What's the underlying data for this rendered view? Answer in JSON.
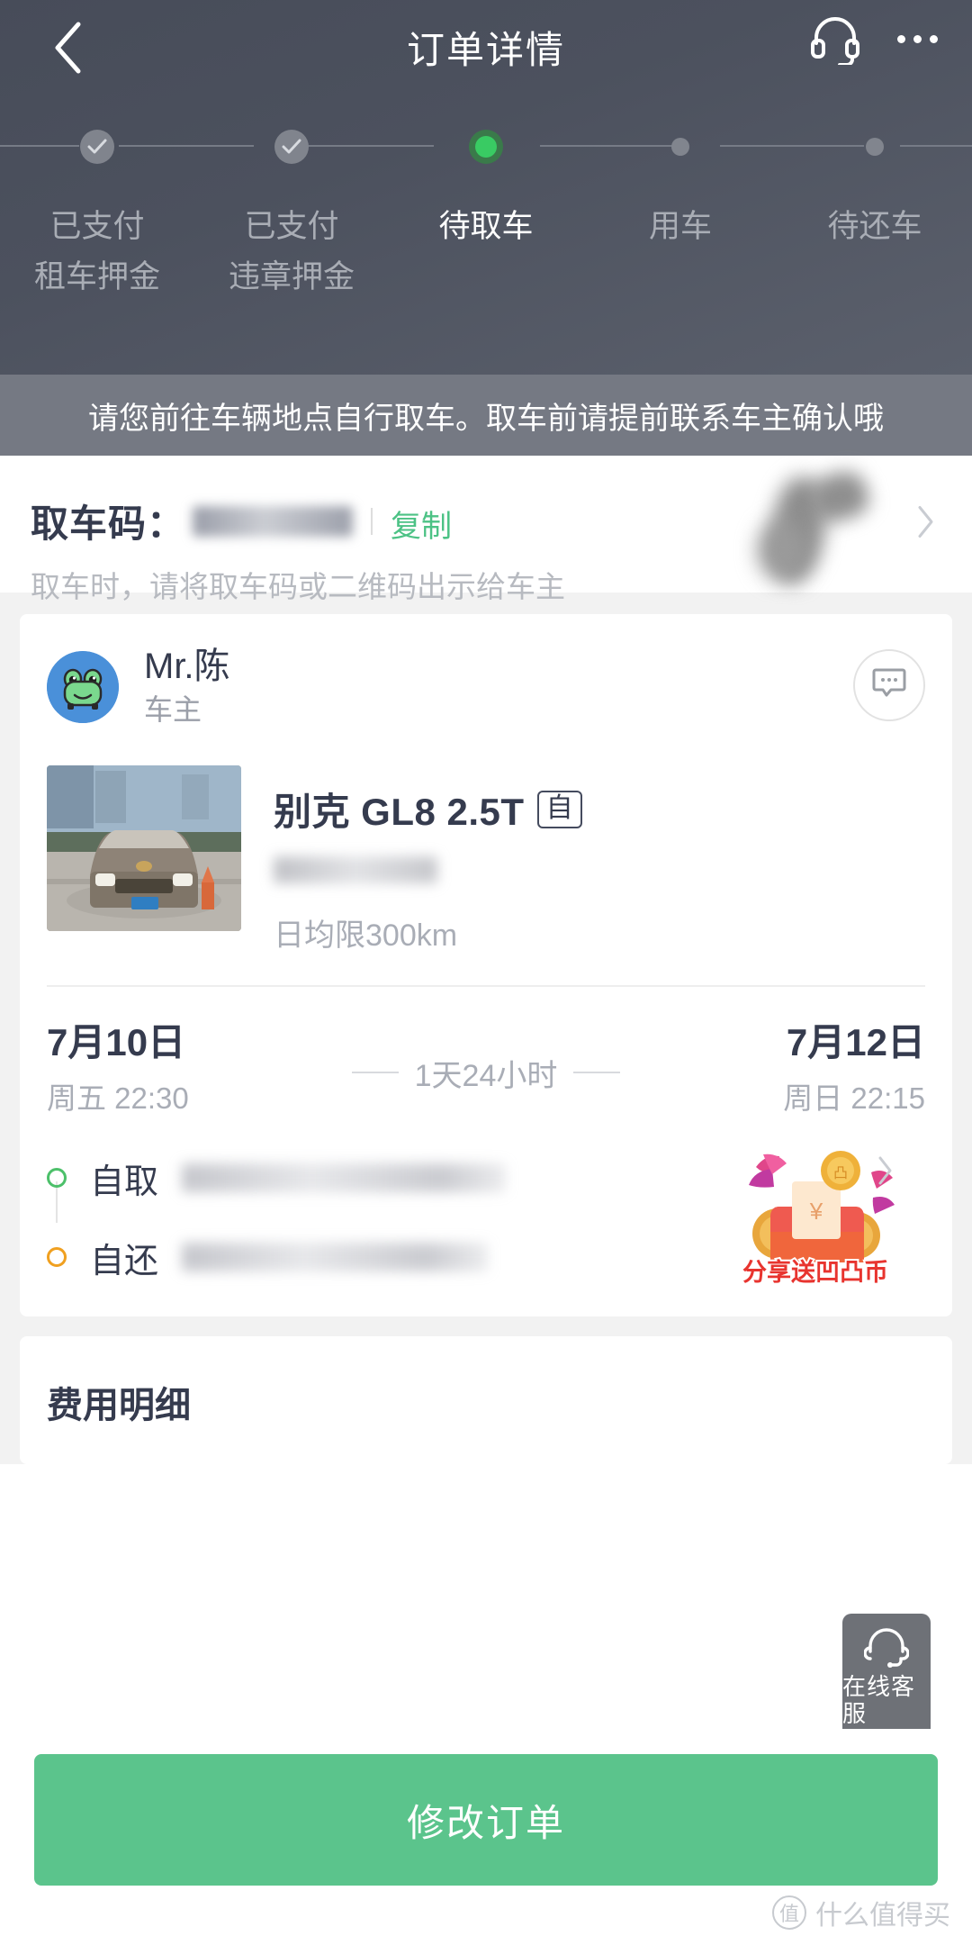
{
  "header": {
    "title": "订单详情",
    "back_icon": "chevron-left-icon",
    "service_icon": "headset-icon",
    "more_icon": "more-dots-icon"
  },
  "stepper": {
    "steps": [
      {
        "label_top": "已支付",
        "label_bottom": "租车押金",
        "state": "done"
      },
      {
        "label_top": "已支付",
        "label_bottom": "违章押金",
        "state": "done"
      },
      {
        "label_top": "待取车",
        "label_bottom": "",
        "state": "active"
      },
      {
        "label_top": "用车",
        "label_bottom": "",
        "state": "todo"
      },
      {
        "label_top": "待还车",
        "label_bottom": "",
        "state": "todo"
      }
    ],
    "active_color": "#39cb63"
  },
  "notice": {
    "text": "请您前往车辆地点自行取车。取车前请提前联系车主确认哦"
  },
  "pickup": {
    "label": "取车码：",
    "code_masked": "",
    "copy_label": "复制",
    "sub_text": "取车时，请将取车码或二维码出示给车主",
    "qr_icon": "qr-code-thumbnail",
    "chevron_icon": "chevron-right-icon",
    "copy_color": "#4cc285"
  },
  "owner": {
    "name": "Mr.陈",
    "role": "车主",
    "avatar_icon": "frog-avatar-icon",
    "chat_icon": "chat-bubble-icon"
  },
  "car": {
    "photo_icon": "car-photo-thumbnail",
    "title": "别克 GL8 2.5T",
    "transmission_tag": "自",
    "plate_masked": "",
    "mileage_limit": "日均限300km"
  },
  "rental": {
    "start_date": "7月10日",
    "start_weekday_time": "周五  22:30",
    "duration": "1天24小时",
    "end_date": "7月12日",
    "end_weekday_time": "周日  22:15"
  },
  "locations": {
    "pickup_label": "自取",
    "pickup_address_masked": "",
    "return_label": "自还",
    "return_address_masked": "",
    "pickup_dot_color": "#4cc06a",
    "return_dot_color": "#f0a020",
    "chevron_icon": "chevron-right-icon"
  },
  "promo": {
    "banner_icon": "share-reward-coins-icon",
    "banner_text": "分享送凹凸币"
  },
  "fee": {
    "title": "费用明细"
  },
  "customer_service": {
    "label": "在线客服",
    "icon": "headset-icon"
  },
  "footer": {
    "cta_label": "修改订单",
    "cta_color": "#5bc48c"
  },
  "watermark": {
    "badge": "值",
    "text": "什么值得买"
  }
}
